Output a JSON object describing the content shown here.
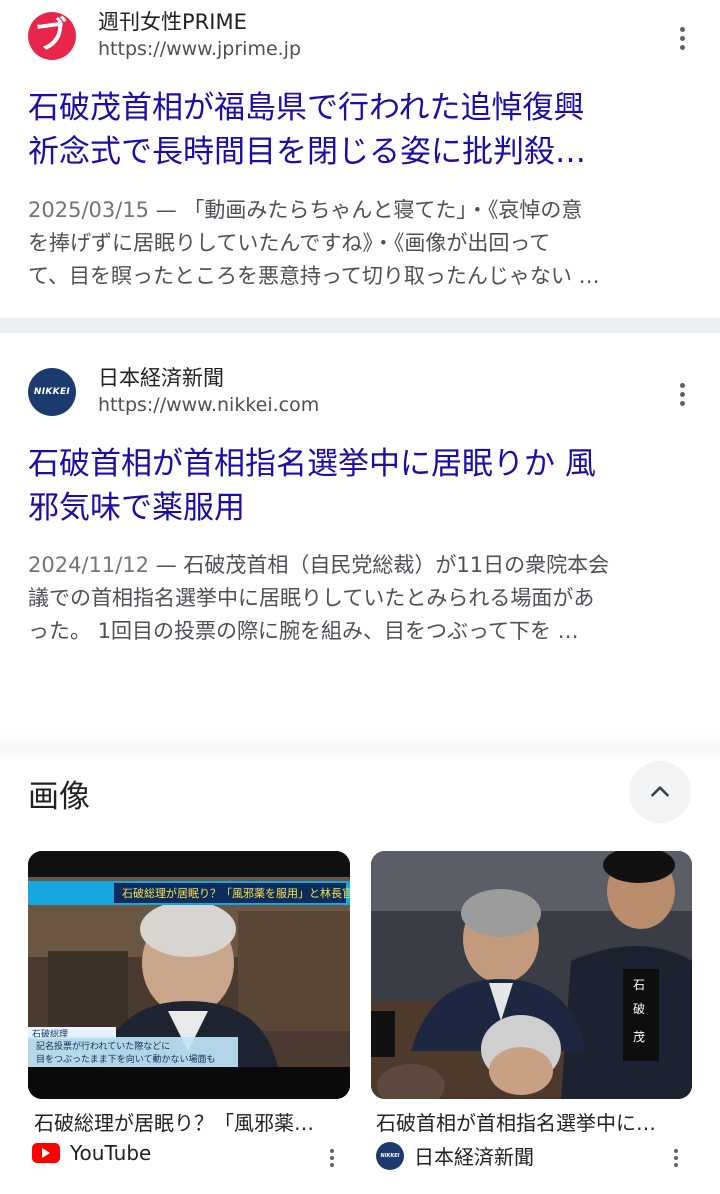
{
  "results": [
    {
      "site_name": "週刊女性PRIME",
      "url": "https://www.jprime.jp",
      "favicon_glyph": "ブ",
      "favicon_icon": "jprime-logo-icon",
      "title_lines": [
        "石破茂首相が福島県で行われた追悼復興",
        "祈念式で長時間目を閉じる姿に批判殺…"
      ],
      "date": "2025/03/15",
      "snippet_lines": [
        " — 「動画みたらちゃんと寝てた」・《哀悼の意",
        "を捧げずに居眠りしていたんですね》・《画像が出回って",
        "て、目を瞑ったところを悪意持って切り取ったんじゃない …"
      ]
    },
    {
      "site_name": "日本経済新聞",
      "url": "https://www.nikkei.com",
      "favicon_glyph": "NIKKEI",
      "favicon_icon": "nikkei-logo-icon",
      "title_lines": [
        "石破首相が首相指名選挙中に居眠りか 風",
        "邪気味で薬服用"
      ],
      "date": "2024/11/12",
      "snippet_lines": [
        " — 石破茂首相（自民党総裁）が11日の衆院本会",
        "議での首相指名選挙中に居眠りしていたとみられる場面があ",
        "った。 1回目の投票の際に腕を組み、目をつぶって下を …"
      ]
    }
  ],
  "images": {
    "heading": "画像",
    "items": [
      {
        "title": "石破総理が居眠り？「風邪薬…",
        "source": "YouTube",
        "source_icon": "youtube-icon",
        "thumb_banner": "石破総理が居眠り？「風邪薬を服用」と林長官が説明",
        "thumb_caption_lines": [
          "記名投票が行われていた際などに",
          "目をつぶったまま下を向いて動かない場面も"
        ],
        "thumb_label": "石破総理"
      },
      {
        "title": "石破首相が首相指名選挙中に…",
        "source": "日本経済新聞",
        "source_icon": "nikkei-icon",
        "thumb_label": "石破 茂"
      }
    ]
  },
  "colors": {
    "link": "#1a0dab",
    "snippet": "#4d5156",
    "separator": "#eceff1",
    "youtube_red": "#ff0000",
    "prime_red": "#e8264b",
    "nikkei_navy": "#1b3b6f"
  }
}
